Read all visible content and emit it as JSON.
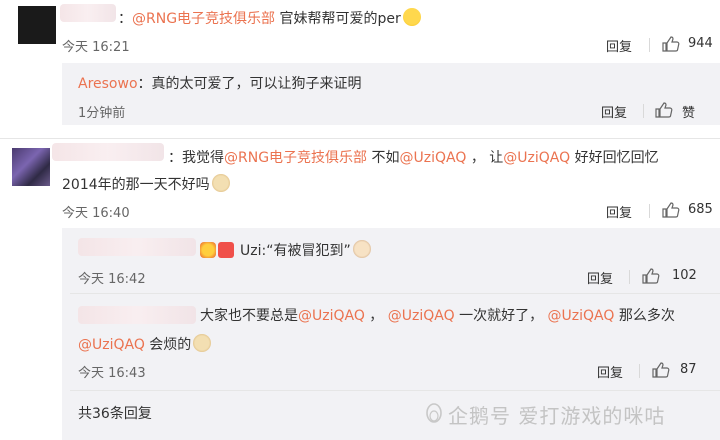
{
  "comments": [
    {
      "prefix": "：",
      "mention": "@RNG电子竞技俱乐部",
      "text": " 官妹帮帮可爱的per",
      "time": "今天 16:21",
      "reply_label": "回复",
      "likes": "944"
    },
    {
      "prefix": "：",
      "line1_text1": "我觉得",
      "line1_mention1": "@RNG电子竞技俱乐部",
      "line1_text2": " 不如",
      "line1_mention2": "@UziQAQ",
      "line1_text3": " ，  让",
      "line1_mention3": "@UziQAQ",
      "line1_text4": " 好好回忆回忆",
      "line2_text": "2014年的那一天不好吗",
      "time": "今天 16:40",
      "reply_label": "回复",
      "likes": "685"
    }
  ],
  "replies": [
    {
      "user": "Aresowo",
      "text": "：真的太可爱了，可以让狗子来证明",
      "time": "1分钟前",
      "reply_label": "回复",
      "like_label": "赞"
    },
    {
      "text": "Uzi:“有被冒犯到”",
      "time": "今天 16:42",
      "reply_label": "回复",
      "likes": "102"
    },
    {
      "line1_text1": "大家也不要总是",
      "line1_mention1": "@UziQAQ",
      "line1_text2": " ，  ",
      "line1_mention2": "@UziQAQ",
      "line1_text3": " 一次就好了，  ",
      "line1_mention3": "@UziQAQ",
      "line1_text4": " 那么多次",
      "line2_mention": "@UziQAQ",
      "line2_text": " 会烦的",
      "time": "今天 16:43",
      "reply_label": "回复",
      "likes": "87"
    }
  ],
  "more_replies": "共36条回复",
  "watermark": "企鹅号 爱打游戏的咪咕",
  "colors": {
    "mention": "#eb7350",
    "panel": "#f2f2f5"
  }
}
